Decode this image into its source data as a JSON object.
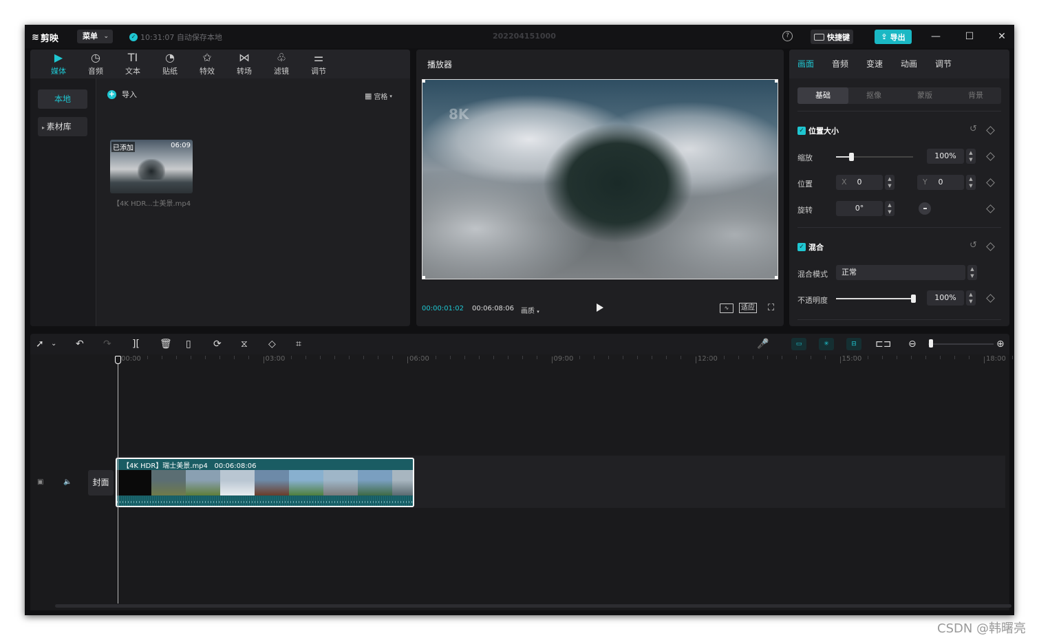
{
  "app": {
    "logo_text": "剪映",
    "menu_label": "菜单",
    "autosave_text": "10:31:07 自动保存本地",
    "project_title": "202204151000",
    "help_icon": "?",
    "shortcut_label": "快捷键",
    "export_label": "导出",
    "minimize": "—",
    "maximize": "☐",
    "close": "✕"
  },
  "media_toolbar": {
    "tabs": [
      {
        "label": "媒体",
        "icon": "▶",
        "active": true
      },
      {
        "label": "音频",
        "icon": "◷"
      },
      {
        "label": "文本",
        "icon": "TI"
      },
      {
        "label": "贴纸",
        "icon": "◔"
      },
      {
        "label": "特效",
        "icon": "✩"
      },
      {
        "label": "转场",
        "icon": "⋈"
      },
      {
        "label": "滤镜",
        "icon": "♧"
      },
      {
        "label": "调节",
        "icon": "⚌"
      }
    ]
  },
  "media": {
    "side_local": "本地",
    "side_library": "素材库",
    "import_label": "导入",
    "view_label": "宫格",
    "thumb": {
      "added_badge": "已添加",
      "duration": "06:09",
      "filename": "【4K HDR...士美景.mp4"
    }
  },
  "player": {
    "title": "播放器",
    "watermark": "8K",
    "current_time": "00:00:01:02",
    "total_time": "00:06:08:06",
    "quality_label": "画质",
    "fit_label": "适应"
  },
  "props": {
    "tabs": [
      "画面",
      "音频",
      "变速",
      "动画",
      "调节"
    ],
    "subtabs": [
      "基础",
      "抠像",
      "蒙版",
      "背景"
    ],
    "section_position": "位置大小",
    "scale_label": "缩放",
    "scale_value": "100%",
    "scale_level": 0.2,
    "position_label": "位置",
    "pos_x_axis": "X",
    "pos_x": "0",
    "pos_y_axis": "Y",
    "pos_y": "0",
    "rotate_label": "旋转",
    "rotate_value": "0°",
    "section_blend": "混合",
    "blend_mode_label": "混合模式",
    "blend_mode_value": "正常",
    "opacity_label": "不透明度",
    "opacity_value": "100%",
    "opacity_level": 1.0
  },
  "timeline": {
    "ruler_labels": [
      "00:00",
      "03:00",
      "06:00",
      "09:00",
      "12:00",
      "15:00",
      "18:00"
    ],
    "cover_label": "封面",
    "clip_label": "【4K HDR】瑞士美景.mp4",
    "clip_duration": "00:06:08:06",
    "clip_frames": [
      {
        "c1": "#0a0a0a",
        "c2": "#0a0a0a"
      },
      {
        "c1": "#5b6e73",
        "c2": "#6f7a4a"
      },
      {
        "c1": "#8aa0b2",
        "c2": "#5f7e3a"
      },
      {
        "c1": "#b9c6d2",
        "c2": "#e8ecef"
      },
      {
        "c1": "#6d8aa8",
        "c2": "#6b3d2a"
      },
      {
        "c1": "#88b0cf",
        "c2": "#4f7f3d"
      },
      {
        "c1": "#9fb6c8",
        "c2": "#7a7a7a"
      },
      {
        "c1": "#7a9fc0",
        "c2": "#3e6a45"
      },
      {
        "c1": "#a8b6c0",
        "c2": "#5a6a70"
      }
    ]
  },
  "watermark": "CSDN @韩曙亮",
  "colors": {
    "accent": "#1fc6d1",
    "clip": "#1a5c63"
  }
}
